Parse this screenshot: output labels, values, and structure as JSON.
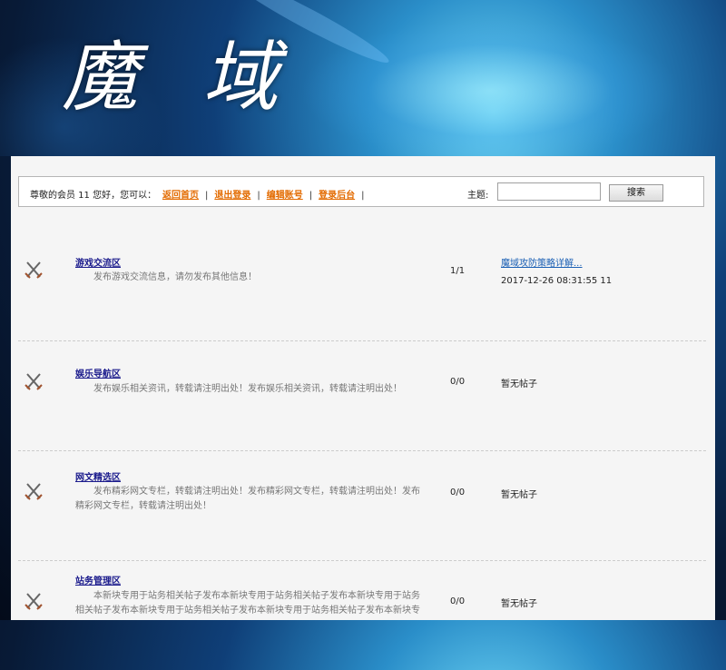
{
  "header": {
    "logo_text": "魔 域"
  },
  "nav": {
    "greeting": "尊敬的会员 11 您好，您可以：",
    "links": [
      "返回首页",
      "退出登录",
      "编辑账号",
      "登录后台"
    ],
    "separator": "|",
    "search_label": "主题:",
    "search_value": "",
    "search_button": "搜索"
  },
  "forums": [
    {
      "title": "游戏交流区",
      "description": "发布游戏交流信息，请勿发布其他信息！",
      "count": "1/1",
      "latest_title": "魔域攻防策略详解...",
      "latest_time": "2017-12-26  08:31:55  11"
    },
    {
      "title": "娱乐导航区",
      "description": "发布娱乐相关资讯，转载请注明出处！发布娱乐相关资讯，转载请注明出处！",
      "count": "0/0",
      "latest_text": "暂无帖子"
    },
    {
      "title": "网文精选区",
      "description": "发布精彩网文专栏，转载请注明出处！发布精彩网文专栏，转载请注明出处！发布精彩网文专栏，转载请注明出处！",
      "count": "0/0",
      "latest_text": "暂无帖子"
    },
    {
      "title": "站务管理区",
      "description": "本新块专用于站务相关帖子发布本新块专用于站务相关帖子发布本新块专用于站务相关帖子发布本新块专用于站务相关帖子发布本新块专用于站务相关帖子发布本新块专",
      "count": "0/0",
      "latest_text": "暂无帖子"
    }
  ],
  "icons": {
    "forum_icon": "crossed-swords-icon"
  },
  "colors": {
    "nav_link": "#e36b00",
    "title_link": "#1a1a8c",
    "latest_link": "#1a5fb4",
    "panel_bg": "#f5f5f5"
  }
}
